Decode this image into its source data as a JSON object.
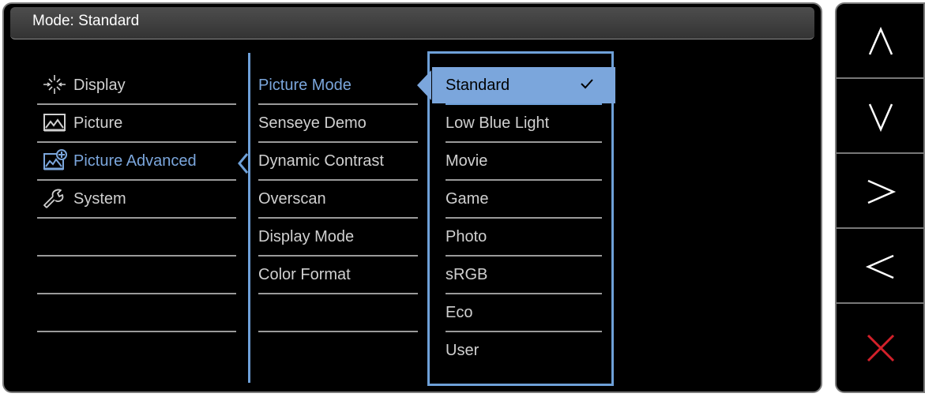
{
  "header": {
    "mode_text": "Mode: Standard"
  },
  "menu_main": [
    {
      "label": "Display",
      "icon": "display-icon",
      "active": false
    },
    {
      "label": "Picture",
      "icon": "picture-icon",
      "active": false
    },
    {
      "label": "Picture Advanced",
      "icon": "picture-advanced-icon",
      "active": true
    },
    {
      "label": "System",
      "icon": "wrench-icon",
      "active": false
    }
  ],
  "menu_sub": [
    "Picture Mode",
    "Senseye Demo",
    "Dynamic Contrast",
    "Overscan",
    "Display Mode",
    "Color Format"
  ],
  "menu_options": [
    "Standard",
    "Low Blue Light",
    "Movie",
    "Game",
    "Photo",
    "sRGB",
    "Eco",
    "User"
  ],
  "selected_option": "Standard",
  "hotkeys": [
    "up-arrow-icon",
    "down-arrow-icon",
    "right-arrow-icon",
    "left-arrow-icon",
    "close-icon"
  ],
  "colors": {
    "accent": "#7ba6dc",
    "close": "#d3202a"
  }
}
